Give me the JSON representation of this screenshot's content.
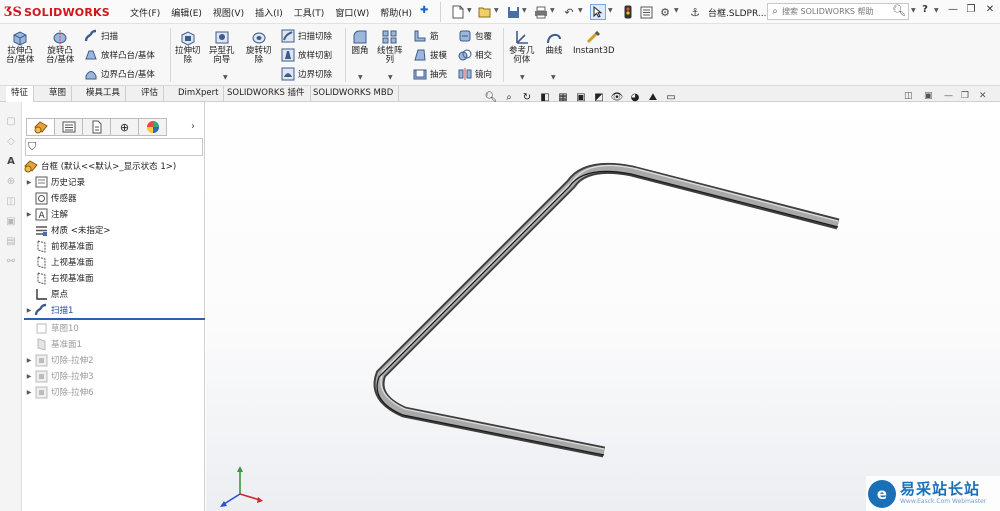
{
  "app": {
    "logo_mark": "ƷS",
    "logo_text": "SOLIDWORKS",
    "document_name": "台框.SLDPR...",
    "search_placeholder": "搜索 SOLIDWORKS 帮助"
  },
  "menu": [
    "文件(F)",
    "编辑(E)",
    "视图(V)",
    "插入(I)",
    "工具(T)",
    "窗口(W)",
    "帮助(H)"
  ],
  "ribbon": {
    "extrude_boss": "拉伸凸\n台/基体",
    "revolve_boss": "旋转凸\n台/基体",
    "sweep": "扫描",
    "loft_boss": "放样凸台/基体",
    "boundary_boss": "边界凸台/基体",
    "extrude_cut": "拉伸切\n除",
    "hole_wizard": "异型孔\n向导",
    "revolve_cut": "旋转切\n除",
    "swept_cut": "扫描切除",
    "lofted_cut": "放样切割",
    "boundary_cut": "边界切除",
    "fillet": "圆角",
    "linear_pattern": "线性阵\n列",
    "rib": "筋",
    "draft": "拔模",
    "shell": "抽壳",
    "wrap": "包覆",
    "intersect": "相交",
    "mirror": "镜向",
    "ref_geometry": "参考几\n何体",
    "curves": "曲线",
    "instant3d": "Instant3D"
  },
  "tabs": [
    "特征",
    "草图",
    "模具工具",
    "评估",
    "DimXpert",
    "SOLIDWORKS 插件",
    "SOLIDWORKS MBD"
  ],
  "tree": {
    "root": "台框 (默认<<默认>_显示状态 1>)",
    "items": [
      {
        "label": "历史记录"
      },
      {
        "label": "传感器"
      },
      {
        "label": "注解"
      },
      {
        "label": "材质 <未指定>"
      },
      {
        "label": "前视基准面"
      },
      {
        "label": "上视基准面"
      },
      {
        "label": "右视基准面"
      },
      {
        "label": "原点"
      },
      {
        "label": "扫描1"
      },
      {
        "label": "草图10"
      },
      {
        "label": "基准面1"
      },
      {
        "label": "切除-拉伸2"
      },
      {
        "label": "切除-拉伸3"
      },
      {
        "label": "切除-拉伸6"
      }
    ]
  },
  "watermark": {
    "mark": "e",
    "name": "易采站长站",
    "url": "Www.Easck.Com Webmaster"
  },
  "colors": {
    "brand": "#d0161c",
    "accent": "#1b63c4",
    "watermark": "#1a6fb7"
  }
}
